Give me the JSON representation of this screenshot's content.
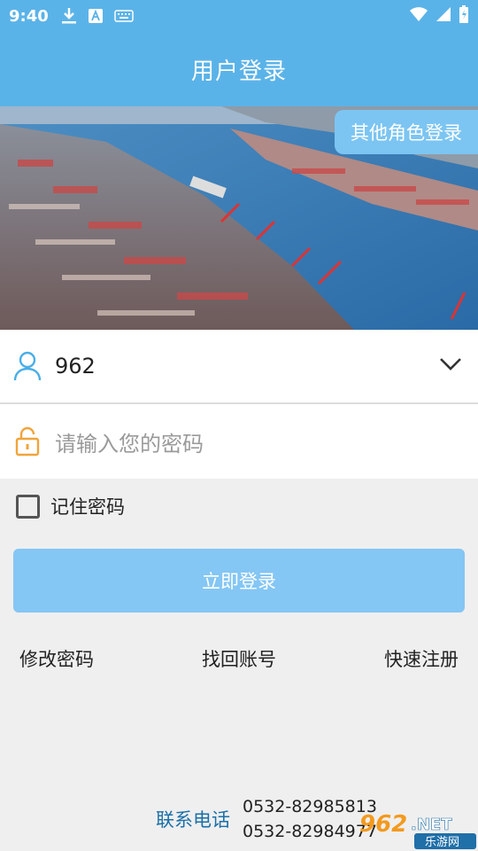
{
  "status_bar": {
    "time": "9:40"
  },
  "header": {
    "title": "用户登录"
  },
  "banner": {
    "role_button": "其他角色登录"
  },
  "login": {
    "username": "962",
    "password_placeholder": "请输入您的密码",
    "remember_label": "记住密码",
    "submit_label": "立即登录"
  },
  "links": {
    "change_password": "修改密码",
    "recover_account": "找回账号",
    "register": "快速注册"
  },
  "contact": {
    "label": "联系电话",
    "phone1": "0532-82985813",
    "phone2": "0532-82984977"
  },
  "watermark": {
    "logo_text": "962.NET",
    "sub_text": "乐游网"
  },
  "colors": {
    "primary": "#5ab3e8",
    "button": "#84c6f4",
    "contact_label": "#1b6fa8",
    "lock_icon": "#f0a43a"
  }
}
